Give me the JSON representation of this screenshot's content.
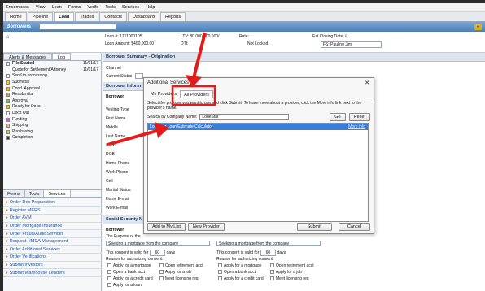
{
  "menu": [
    "Encompass",
    "View",
    "Loan",
    "Forms",
    "Verifs",
    "Tools",
    "Services",
    "Help"
  ],
  "tabs": [
    "Home",
    "Pipeline",
    "Loan",
    "Trades",
    "Contacts",
    "Dashboard",
    "Reports"
  ],
  "borrowers_label": "Borrowers",
  "loaninfo": {
    "loan_num": "Loan #: 1711000105",
    "amount": "Loan Amount: $400,000.00",
    "ltv": "LTV: 80.000/100.000/",
    "dti": "DTI: /",
    "rate": "Rate:",
    "lock": "Not Locked",
    "closing": "Est Closing Date: //",
    "officer": "FS: Paulino Jim"
  },
  "left_tabs": [
    "Alerts & Messages",
    "Log"
  ],
  "milestones": [
    {
      "label": "File Started",
      "date": "11/01/17"
    },
    {
      "label": "Quote for Settlement/Attorney",
      "date": "11/01/17"
    },
    {
      "label": "Send to processing",
      "date": ""
    },
    {
      "label": "Submittal",
      "date": ""
    },
    {
      "label": "Cond. Approval",
      "date": ""
    },
    {
      "label": "Resubmittal",
      "date": ""
    },
    {
      "label": "Approval",
      "date": ""
    },
    {
      "label": "Ready for Docs",
      "date": ""
    },
    {
      "label": "Docs Out",
      "date": ""
    },
    {
      "label": "Funding",
      "date": ""
    },
    {
      "label": "Shipping",
      "date": ""
    },
    {
      "label": "Purchasing",
      "date": ""
    },
    {
      "label": "Completion",
      "date": ""
    }
  ],
  "service_tabs": [
    "Forms",
    "Tools",
    "Services"
  ],
  "services": [
    "Order Doc Preparation",
    "Register MERS",
    "Order AVM",
    "Order Mortgage Insurance",
    "Order Fraud/Audit Services",
    "Request HMDA Management",
    "Order Additional Services",
    "Order Verifications",
    "Submit Investors",
    "Submit Warehouse Lenders"
  ],
  "main": {
    "section": "Borrower Summary - Origination",
    "channel": "Channel",
    "status": "Current Status",
    "borrower_info": "Borrower Inform",
    "borrower": "Borrower",
    "fields": [
      "Vesting Type",
      "First Name",
      "Middle",
      "Last Name",
      "SSN",
      "DOB",
      "Home Phone",
      "Work Phone",
      "Cell",
      "Marital Status",
      "Home E-mail",
      "Work E-mail"
    ],
    "ssn_section": "Social Security N",
    "purpose": "The Purpose of the",
    "seeking": "Seeking a mortgage from the company",
    "valid": "This consent is valid for",
    "days_val": "60",
    "days": "days",
    "reason": "Reason for authorizing consent:",
    "reasons": [
      "Apply for a mortgage",
      "Open a bank acct",
      "Apply for a credit card",
      "Apply for a loan"
    ],
    "reasons2": [
      "Open retirement acct",
      "Apply for a job",
      "Meet licensing req"
    ]
  },
  "dialog": {
    "title": "Additional Services",
    "tabs": [
      "My Providers",
      "All Providers"
    ],
    "instructions": "Select the provider you want to use and click Submit. To learn more about a provider, click the More info link next to the provider's name.",
    "search_label": "Search by Company Name:",
    "search_value": "LodeStar",
    "go": "Go",
    "reset": "Reset",
    "row": "LodeStar Loan Estimate Calculator",
    "more": "More info",
    "add": "Add to My List",
    "new": "New Provider",
    "submit": "Submit",
    "cancel": "Cancel"
  }
}
